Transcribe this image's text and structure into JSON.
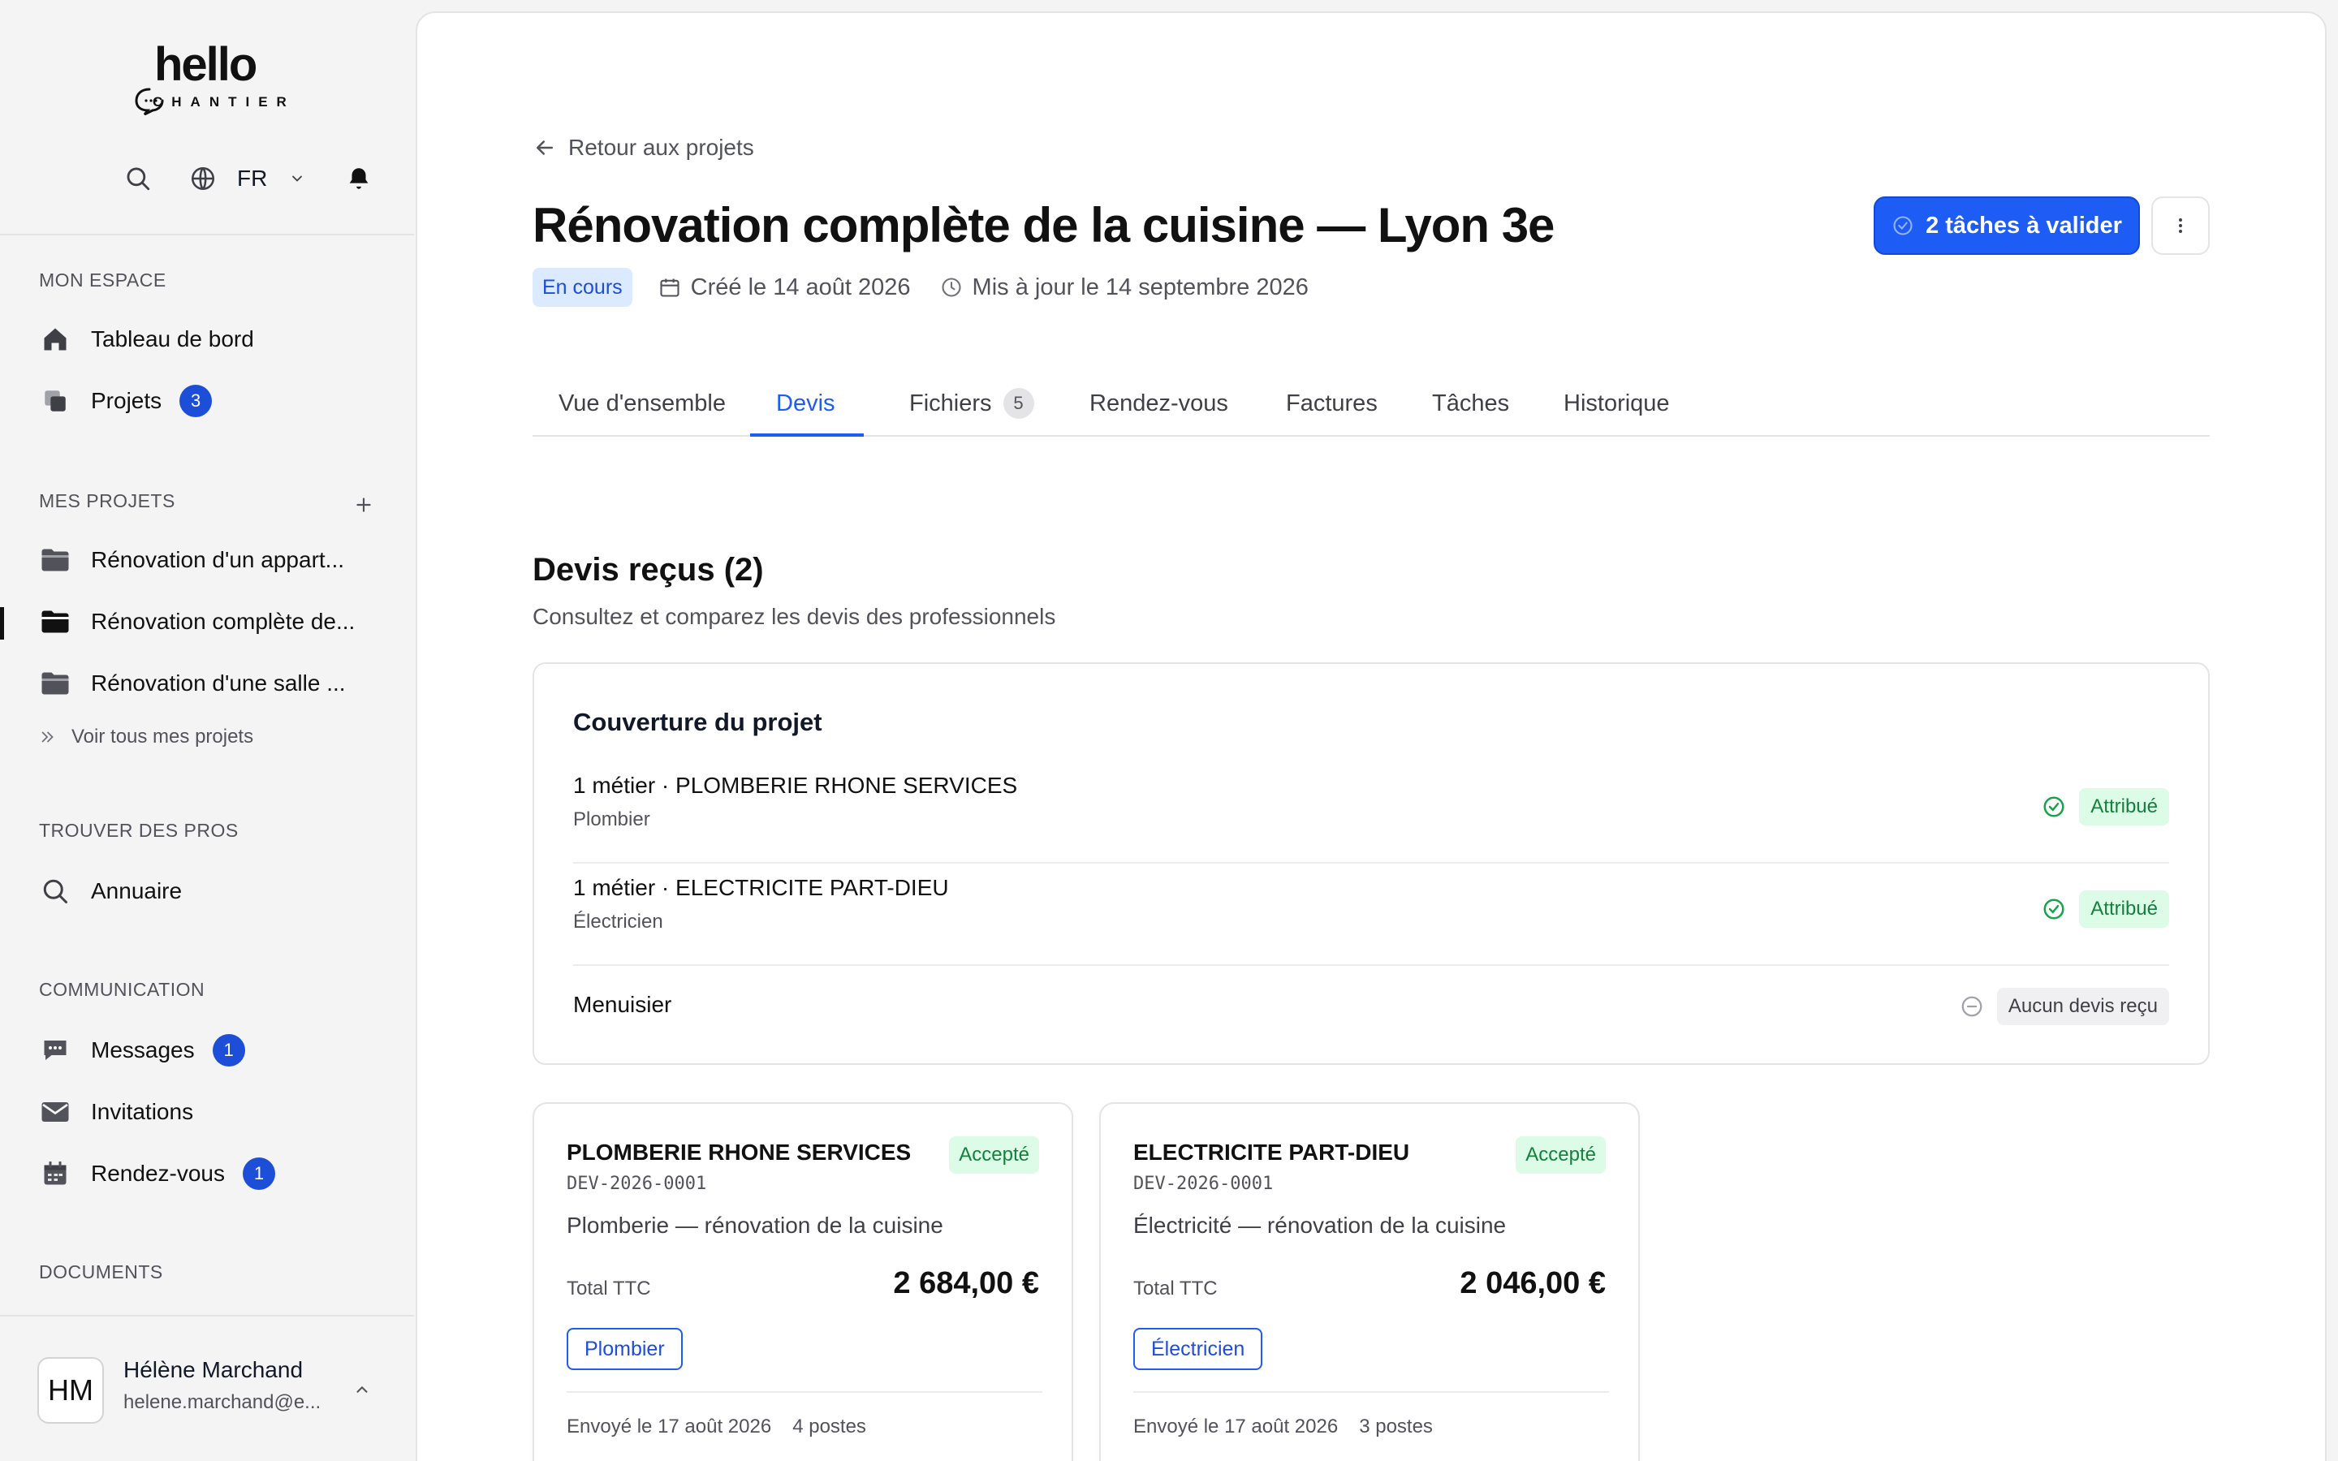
{
  "brand": {
    "logo_main": "hello",
    "logo_sub": "CHANTIER"
  },
  "toolbar": {
    "language": "FR"
  },
  "sidebar": {
    "sections": {
      "my_space": "MON ESPACE",
      "my_projects": "MES PROJETS",
      "find_pros": "TROUVER DES PROS",
      "communication": "COMMUNICATION",
      "documents": "DOCUMENTS"
    },
    "my_space_items": [
      {
        "label": "Tableau de bord"
      },
      {
        "label": "Projets",
        "badge": "3"
      }
    ],
    "projects": [
      {
        "label": "Rénovation d'un appart..."
      },
      {
        "label": "Rénovation complète de..."
      },
      {
        "label": "Rénovation d'une salle ..."
      }
    ],
    "see_all": "Voir tous mes projets",
    "find_items": [
      {
        "label": "Annuaire"
      }
    ],
    "comm_items": [
      {
        "label": "Messages",
        "badge": "1"
      },
      {
        "label": "Invitations"
      },
      {
        "label": "Rendez-vous",
        "badge": "1"
      }
    ]
  },
  "user": {
    "initials": "HM",
    "name": "Hélène Marchand",
    "email": "helene.marchand@e..."
  },
  "header": {
    "back": "Retour aux projets",
    "title": "Rénovation complète de la cuisine — Lyon 3e",
    "status": "En cours",
    "created": "Créé le 14 août 2026",
    "updated": "Mis à jour le 14 septembre 2026",
    "validate_button": "2 tâches à valider"
  },
  "tabs": [
    {
      "label": "Vue d'ensemble"
    },
    {
      "label": "Devis",
      "active": true
    },
    {
      "label": "Fichiers",
      "count": "5"
    },
    {
      "label": "Rendez-vous"
    },
    {
      "label": "Factures"
    },
    {
      "label": "Tâches"
    },
    {
      "label": "Historique"
    }
  ],
  "quotes_section": {
    "title": "Devis reçus (2)",
    "subtitle": "Consultez et comparez les devis des professionnels"
  },
  "coverage": {
    "title": "Couverture du projet",
    "rows": [
      {
        "title": "1 métier · PLOMBERIE RHONE SERVICES",
        "sub": "Plombier",
        "status": "Attribué"
      },
      {
        "title": "1 métier · ELECTRICITE PART-DIEU",
        "sub": "Électricien",
        "status": "Attribué"
      },
      {
        "title": "Menuisier",
        "status": "Aucun devis reçu"
      }
    ]
  },
  "quotes": [
    {
      "company": "PLOMBERIE RHONE SERVICES",
      "ref": "DEV-2026-0001",
      "status": "Accepté",
      "description": "Plomberie — rénovation de la cuisine",
      "total_label": "Total TTC",
      "total": "2 684,00 €",
      "trade": "Plombier",
      "sent": "Envoyé le 17 août 2026",
      "items": "4 postes"
    },
    {
      "company": "ELECTRICITE PART-DIEU",
      "ref": "DEV-2026-0001",
      "status": "Accepté",
      "description": "Électricité — rénovation de la cuisine",
      "total_label": "Total TTC",
      "total": "2 046,00 €",
      "trade": "Électricien",
      "sent": "Envoyé le 17 août 2026",
      "items": "3 postes"
    }
  ],
  "colors": {
    "primary": "#1d5cf5",
    "success": "#15803d",
    "sidebar_bg": "#f4f4f5"
  }
}
